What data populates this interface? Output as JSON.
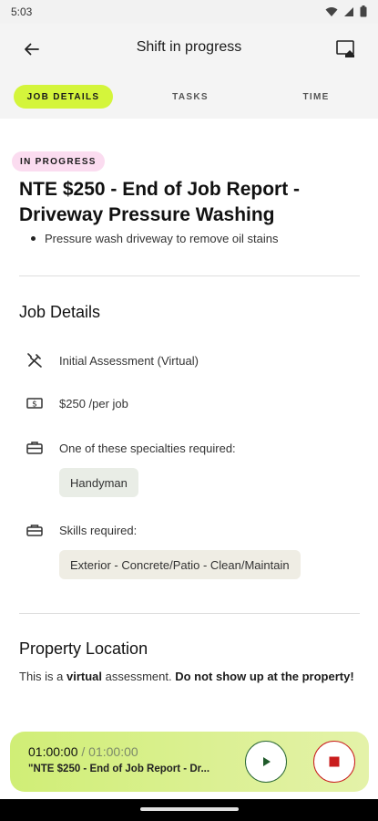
{
  "status_bar": {
    "time": "5:03"
  },
  "app_bar": {
    "title": "Shift in progress"
  },
  "tabs": [
    {
      "label": "JOB DETAILS",
      "active": true
    },
    {
      "label": "TASKS",
      "active": false
    },
    {
      "label": "TIME",
      "active": false
    }
  ],
  "job": {
    "status_badge": "IN PROGRESS",
    "title": "NTE $250 - End of Job Report - Driveway Pressure Washing",
    "description_bullets": [
      "Pressure wash driveway to remove oil stains"
    ]
  },
  "job_details": {
    "heading": "Job Details",
    "assessment_type": "Initial Assessment (Virtual)",
    "rate": "$250 /per job",
    "specialties_label": "One of these specialties required:",
    "specialties": [
      "Handyman"
    ],
    "skills_label": "Skills required:",
    "skills": [
      "Exterior - Concrete/Patio - Clean/Maintain"
    ]
  },
  "property_location": {
    "heading": "Property Location",
    "text_part1": "This is a ",
    "text_bold1": "virtual",
    "text_part2": " assessment. ",
    "text_bold2": "Do not show up at the property!"
  },
  "timer": {
    "elapsed": "01:00:00",
    "separator": " / ",
    "total": "01:00:00",
    "job_label": "\"NTE $250 - End of Job Report - Dr..."
  },
  "colors": {
    "accent": "#d4f53b",
    "badge": "#fbdcf0",
    "play": "#2e6a37",
    "stop": "#c91c1c"
  },
  "icons": {
    "back": "arrow-left-icon",
    "action": "home-screen-icon",
    "assessment": "tools-icon",
    "rate": "dollar-bill-icon",
    "specialties": "briefcase-icon",
    "skills": "toolbox-icon",
    "play": "play-icon",
    "stop": "stop-icon"
  }
}
